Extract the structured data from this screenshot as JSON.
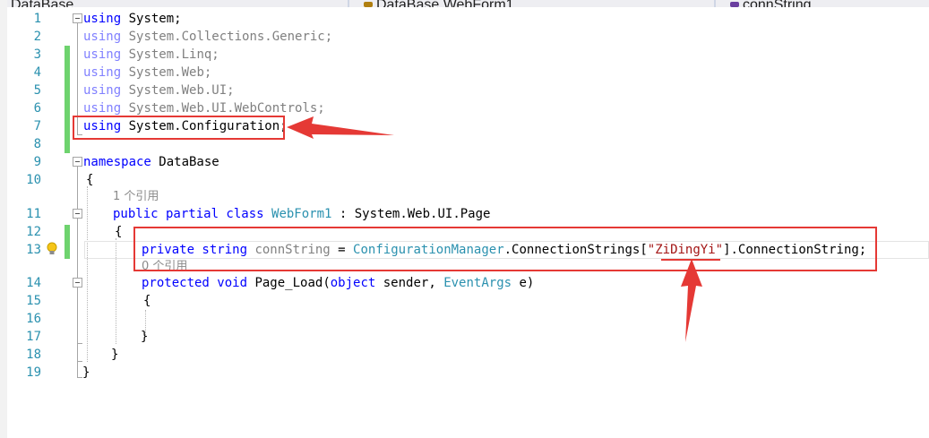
{
  "tabs": [
    {
      "label": "DataBase"
    },
    {
      "label": "DataBase.WebForm1"
    },
    {
      "label": "connString"
    }
  ],
  "line_numbers": [
    "1",
    "2",
    "3",
    "4",
    "5",
    "6",
    "7",
    "8",
    "9",
    "10",
    "11",
    "12",
    "13",
    "14",
    "15",
    "16",
    "17",
    "18",
    "19"
  ],
  "code": {
    "l1": {
      "kw": "using",
      "rest": " System;"
    },
    "l2": {
      "kw": "using",
      "rest": " System.Collections.Generic;"
    },
    "l3": {
      "kw": "using",
      "rest": " System.Linq;"
    },
    "l4": {
      "kw": "using",
      "rest": " System.Web;"
    },
    "l5": {
      "kw": "using",
      "rest": " System.Web.UI;"
    },
    "l6": {
      "kw": "using",
      "rest": " System.Web.UI.WebControls;"
    },
    "l7": {
      "kw": "using",
      "rest": " System.Configuration;"
    },
    "l9": {
      "kw": "namespace",
      "rest": " DataBase"
    },
    "l10": "{",
    "codelens_class": "1 个引用",
    "l11": {
      "mods": "public partial class",
      "name": "WebForm1",
      "sep": " : ",
      "base": "System.Web.UI.Page"
    },
    "l12": "{",
    "l13": {
      "mods": "private string",
      "field": "connString",
      "eq": " = ",
      "cls": "ConfigurationManager",
      "member": ".ConnectionStrings[",
      "str": "\"ZiDingYi\"",
      "tail": "].ConnectionString;"
    },
    "codelens_method": "0 个引用",
    "l14": {
      "mods": "protected void",
      "name": "Page_Load",
      "open": "(",
      "ptype": "object",
      "pname": " sender",
      "comma": ", ",
      "ptype2": "EventArgs",
      "pname2": " e",
      "close": ")"
    },
    "l15": "{",
    "l17": "}",
    "l18": "}",
    "l19": "}"
  },
  "colors": {
    "keyword": "#0000ff",
    "type": "#2b91af",
    "string": "#a31515",
    "line_number": "#2b91af",
    "annotation": "#e53935",
    "change_bar": "#6ed36e"
  }
}
